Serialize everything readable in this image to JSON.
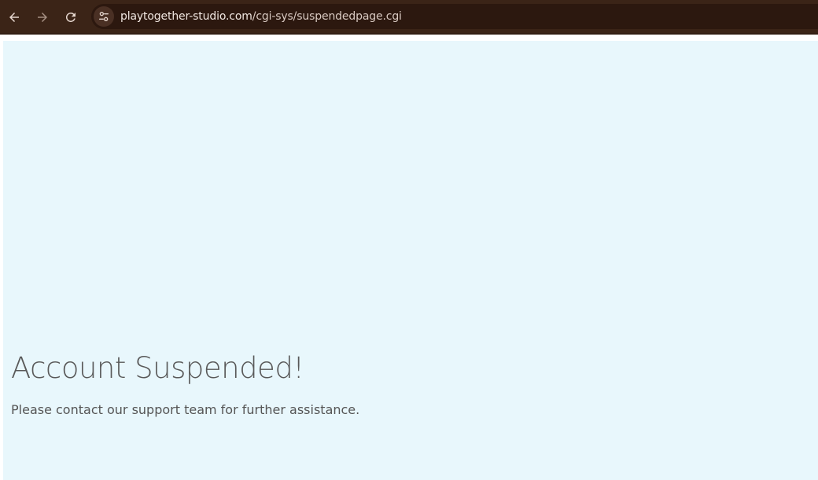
{
  "browser": {
    "url": {
      "domain": "playtogether-studio.com",
      "path": "/cgi-sys/suspendedpage.cgi"
    },
    "icons": {
      "back": "arrow-left-icon",
      "forward": "arrow-right-icon",
      "reload": "reload-icon",
      "site_info": "site-info-tune-icon"
    }
  },
  "page": {
    "title": "Account Suspended!",
    "message": "Please contact our support team for further assistance."
  },
  "colors": {
    "browser_bar": "#3b2417",
    "address_bar": "#2c180f",
    "page_background": "#e8f7fc",
    "text": "#595959"
  }
}
